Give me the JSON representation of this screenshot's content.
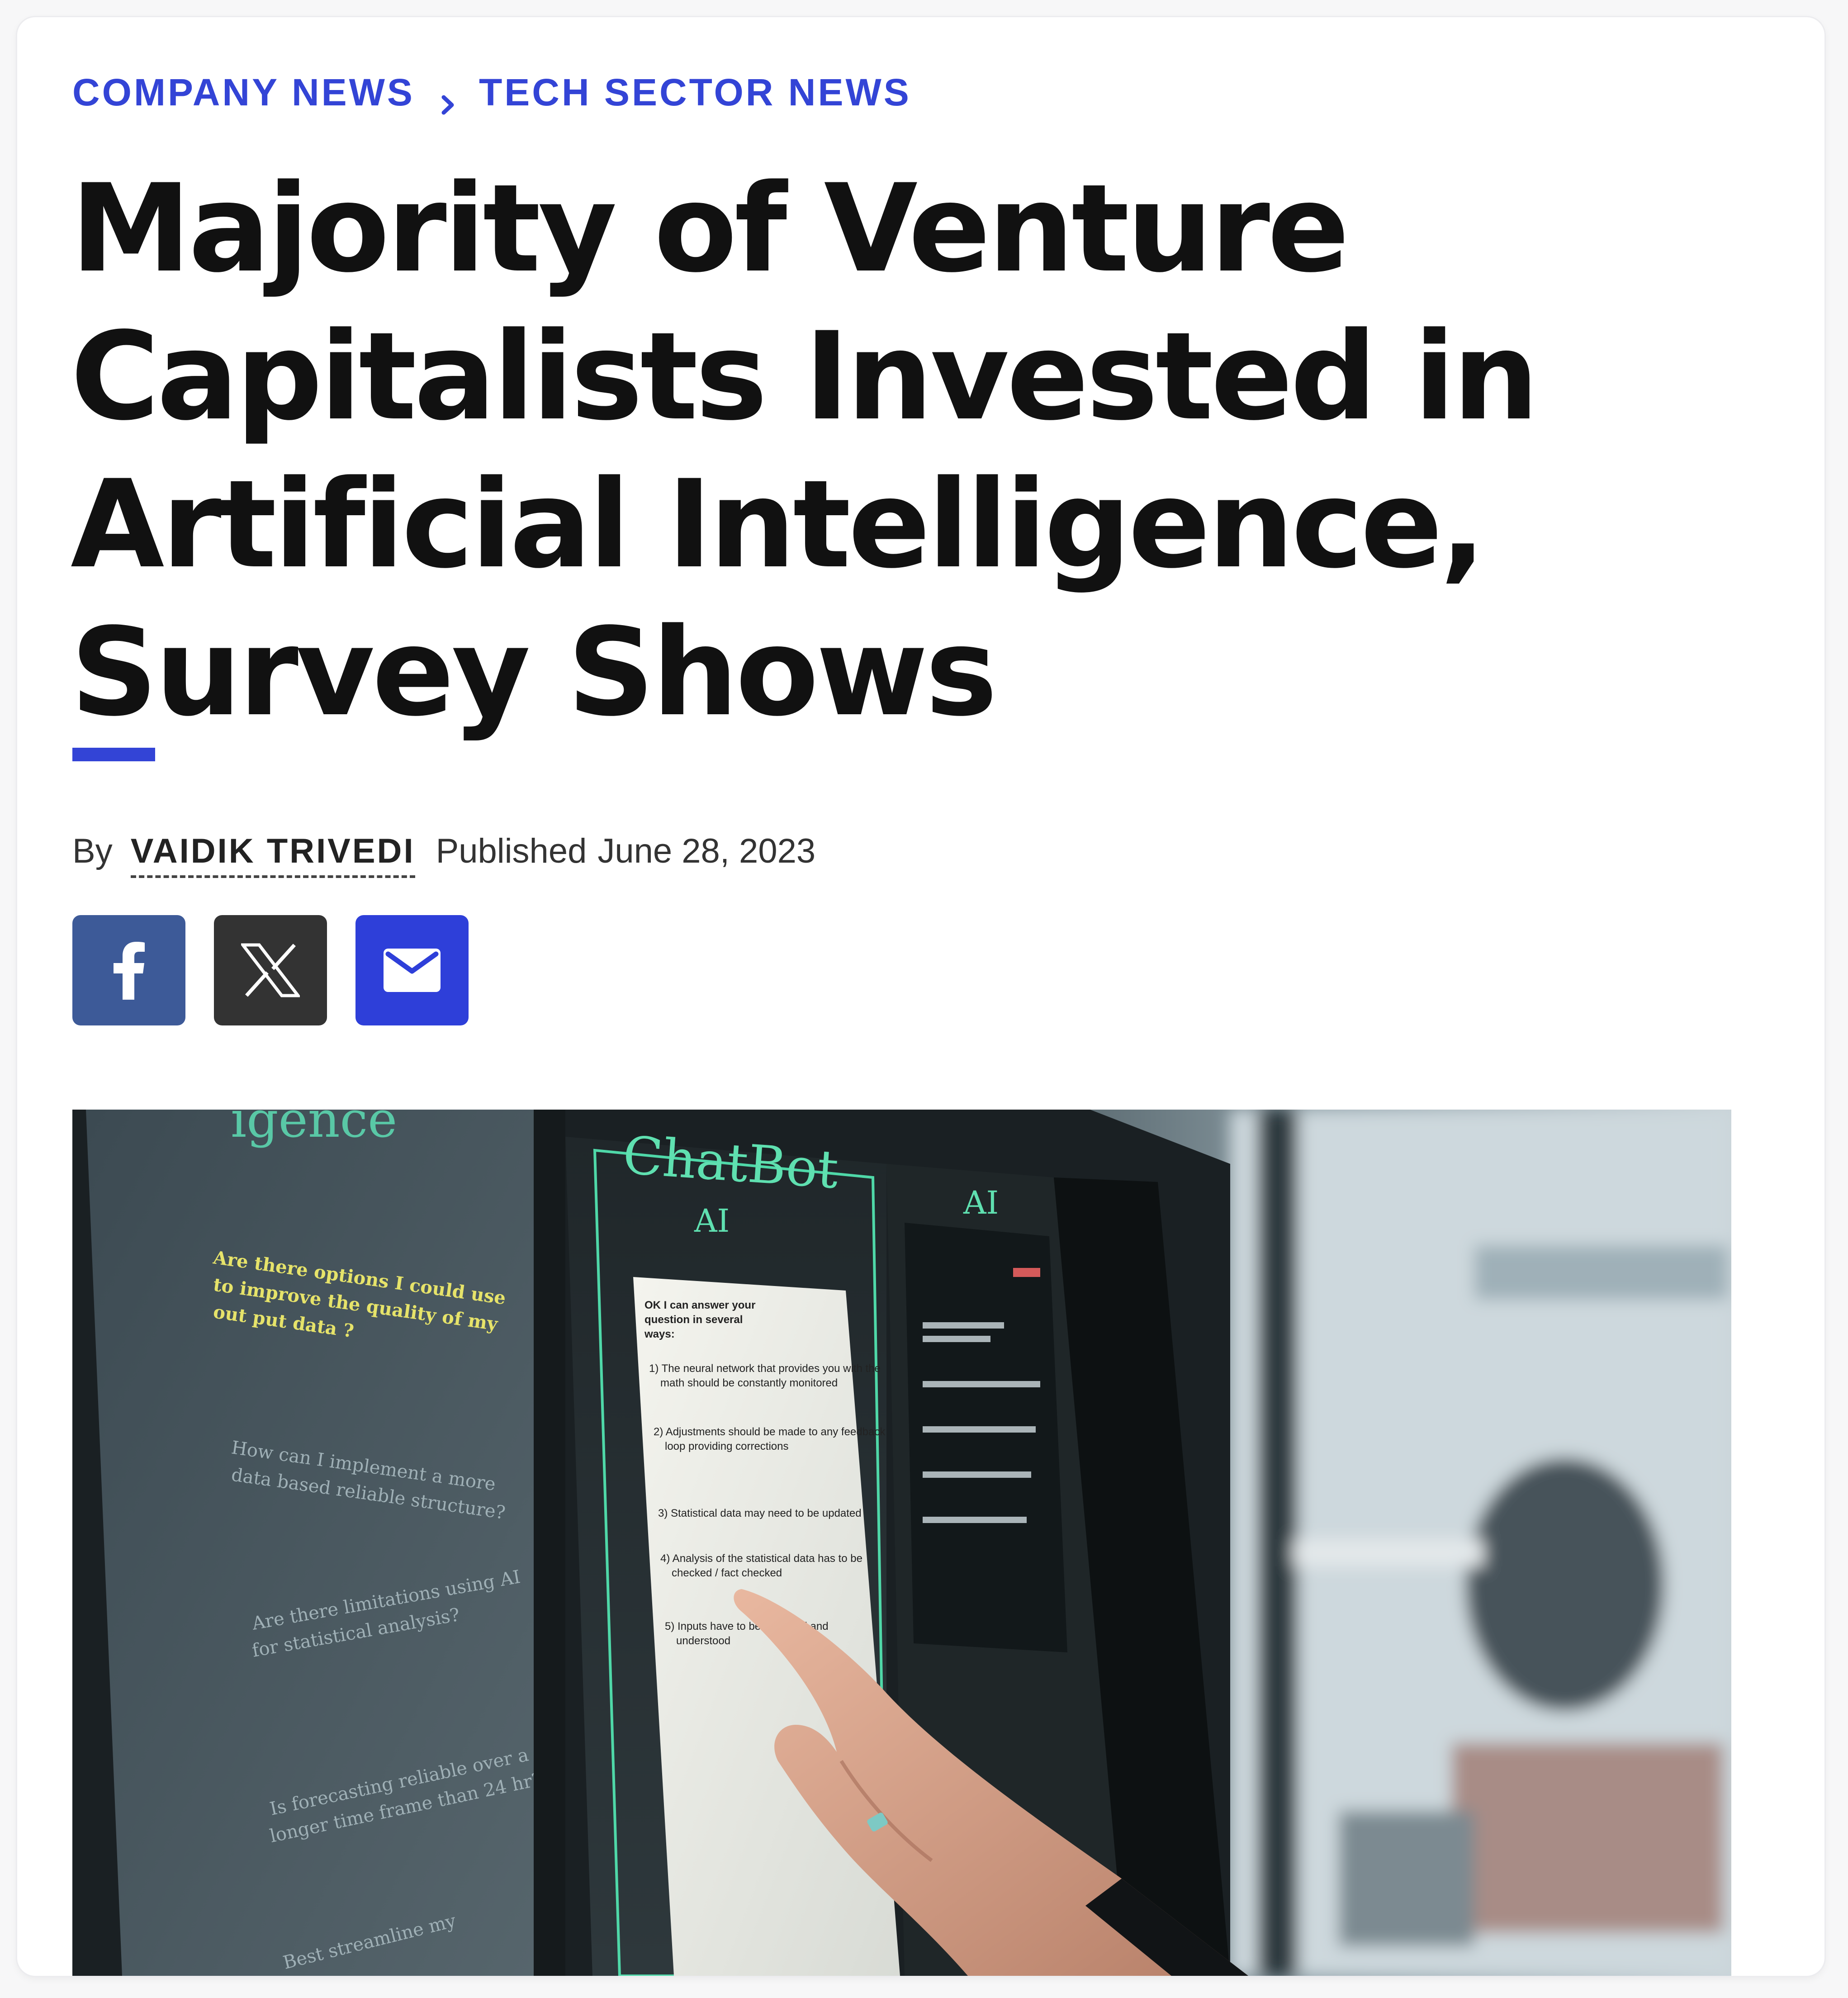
{
  "breadcrumb": {
    "items": [
      {
        "label": "COMPANY NEWS"
      },
      {
        "label": "TECH SECTOR NEWS"
      }
    ]
  },
  "article": {
    "headline": "Majority of Venture Capitalists Invested in Artificial Intelligence, Survey Shows",
    "byline": {
      "by_label": "By",
      "author": "VAIDIK TRIVEDI",
      "published_label": "Published",
      "published_date": "June 28, 2023"
    }
  },
  "share": {
    "buttons": [
      {
        "icon": "facebook-icon",
        "color": "#3d5a98"
      },
      {
        "icon": "x-icon",
        "color": "#333333"
      },
      {
        "icon": "email-icon",
        "color": "#2e3fd9"
      }
    ]
  },
  "hero_image": {
    "screen_texts": {
      "left_header": "igence",
      "chatbot_title": "ChatBot",
      "chatbot_sub": "AI",
      "right_title": "AI",
      "q1": "Are there options I could use to improve the quality of my out put data ?",
      "q2": "How can I implement a more data based reliable structure?",
      "q3": "Are there limitations using AI for statistical analysis?",
      "q4": "Is forecasting reliable over a longer time frame than 24 hr?",
      "q5": "Best streamline my",
      "answer_intro": "OK I can answer your question in several ways:",
      "a1": "1)  The neural network that provides you with the math should be constantly monitored",
      "a2": "2)  Adjustments should be made to any feedback loop providing corrections",
      "a3": "3)  Statistical data may need to be updated",
      "a4": "4)  Analysis of the statistical data has to be checked / fact checked",
      "a5": "5)  Inputs have to be reviewed and understood"
    },
    "colors": {
      "brand_blue": "#3344d6",
      "chatbot_green": "#5fe0b0",
      "question_yellow": "#e6e36a"
    }
  }
}
